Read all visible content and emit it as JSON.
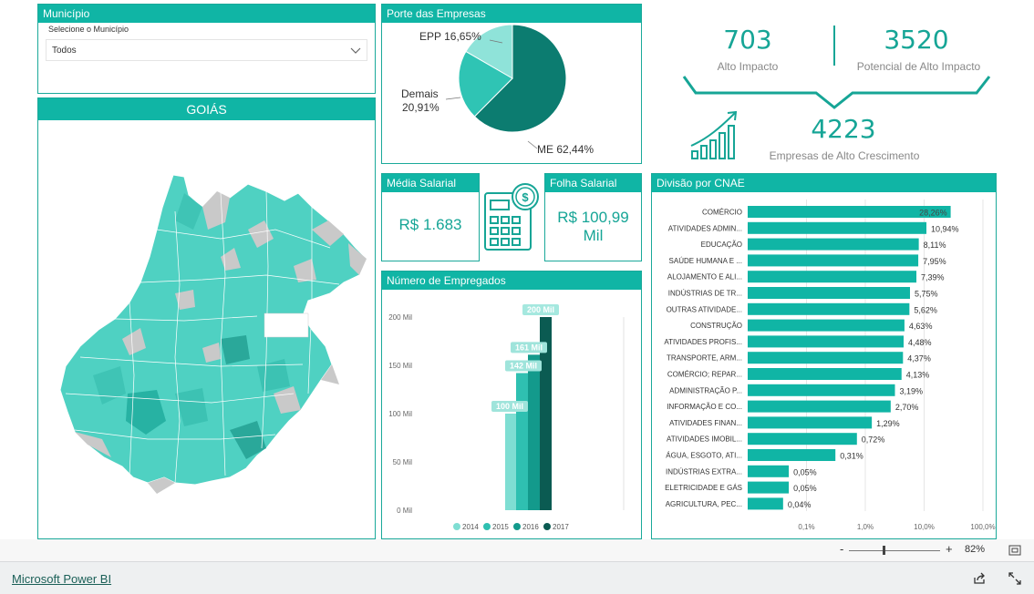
{
  "colors": {
    "accent": "#10b5a5",
    "dark": "#0c7c70",
    "mid": "#2fc4b4",
    "light": "#8fe3d9"
  },
  "municipio": {
    "title": "Município",
    "label": "Selecione o Município",
    "value": "Todos"
  },
  "map": {
    "title": "GOIÁS"
  },
  "porte": {
    "title": "Porte das Empresas",
    "labels": {
      "epp": "EPP 16,65%",
      "demais_1": "Demais",
      "demais_2": "20,91%",
      "me": "ME 62,44%"
    }
  },
  "kpi": {
    "alto_impacto_value": "703",
    "alto_impacto_label": "Alto Impacto",
    "potencial_value": "3520",
    "potencial_label": "Potencial de Alto Impacto",
    "alto_crescimento_value": "4223",
    "alto_crescimento_label": "Empresas de Alto Crescimento"
  },
  "media_salarial": {
    "title": "Média Salarial",
    "value": "R$ 1.683"
  },
  "folha_salarial": {
    "title": "Folha Salarial",
    "value_1": "R$ 100,99",
    "value_2": "Mil"
  },
  "empregados": {
    "title": "Número de Empregados"
  },
  "cnae": {
    "title": "Divisão por CNAE"
  },
  "zoom": {
    "minus": "-",
    "plus": "+",
    "value": "82%"
  },
  "footer": {
    "link": "Microsoft Power BI"
  },
  "chart_data": [
    {
      "type": "pie",
      "title": "Porte das Empresas",
      "categories": [
        "ME",
        "Demais",
        "EPP"
      ],
      "values": [
        62.44,
        20.91,
        16.65
      ]
    },
    {
      "type": "bar",
      "title": "Número de Empregados",
      "categories": [
        "2014",
        "2015",
        "2016",
        "2017"
      ],
      "values": [
        100,
        142,
        161,
        200
      ],
      "value_labels": [
        "100 Mil",
        "142 Mil",
        "161 Mil",
        "200 Mil"
      ],
      "yticks": [
        "0 Mil",
        "50 Mil",
        "100 Mil",
        "150 Mil",
        "200 Mil"
      ],
      "ylim": [
        0,
        200
      ],
      "legend": [
        "2014",
        "2015",
        "2016",
        "2017"
      ]
    },
    {
      "type": "bar",
      "title": "Divisão por CNAE",
      "orientation": "horizontal",
      "scale": "log",
      "xticks": [
        "0,1%",
        "1,0%",
        "10,0%",
        "100,0%"
      ],
      "xlim": [
        0.1,
        100
      ],
      "categories": [
        "COMÉRCIO",
        "ATIVIDADES ADMIN...",
        "EDUCAÇÃO",
        "SAÚDE HUMANA E ...",
        "ALOJAMENTO E ALI...",
        "INDÚSTRIAS DE TR...",
        "OUTRAS ATIVIDADE...",
        "CONSTRUÇÃO",
        "ATIVIDADES PROFIS...",
        "TRANSPORTE, ARM...",
        "COMÉRCIO; REPAR...",
        "ADMINISTRAÇÃO P...",
        "INFORMAÇÃO E CO...",
        "ATIVIDADES FINAN...",
        "ATIVIDADES IMOBIL...",
        "ÁGUA, ESGOTO, ATI...",
        "INDÚSTRIAS EXTRA...",
        "ELETRICIDADE E GÁS",
        "AGRICULTURA, PEC..."
      ],
      "values": [
        28.26,
        10.94,
        8.11,
        7.95,
        7.39,
        5.75,
        5.62,
        4.63,
        4.48,
        4.37,
        4.13,
        3.19,
        2.7,
        1.29,
        0.72,
        0.31,
        0.05,
        0.05,
        0.04
      ],
      "value_labels": [
        "28,26%",
        "10,94%",
        "8,11%",
        "7,95%",
        "7,39%",
        "5,75%",
        "5,62%",
        "4,63%",
        "4,48%",
        "4,37%",
        "4,13%",
        "3,19%",
        "2,70%",
        "1,29%",
        "0,72%",
        "0,31%",
        "0,05%",
        "0,05%",
        "0,04%"
      ]
    }
  ]
}
